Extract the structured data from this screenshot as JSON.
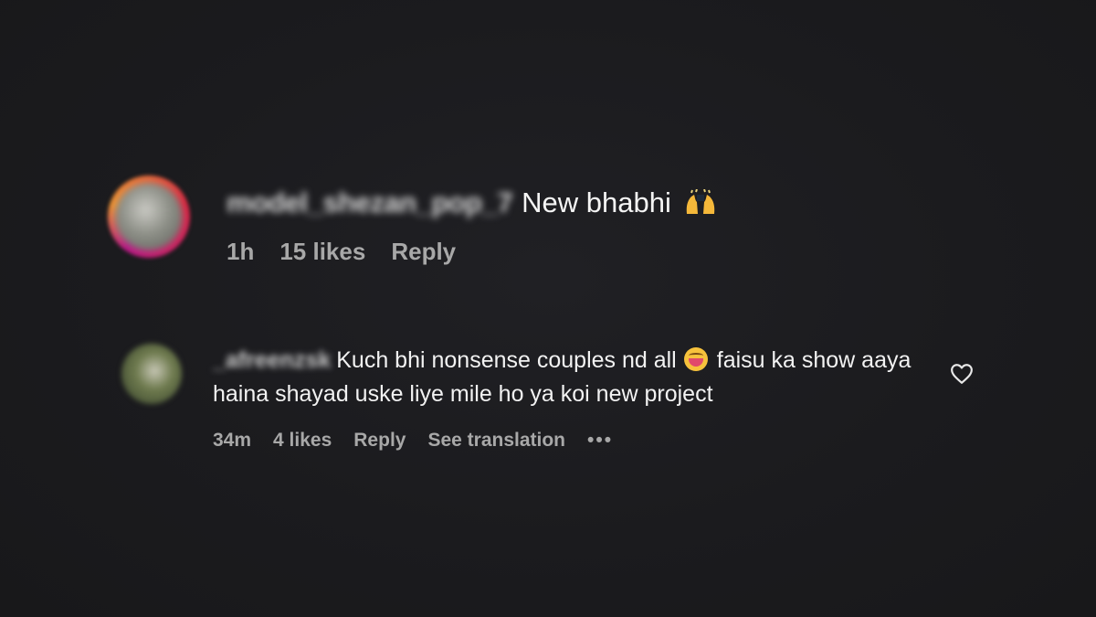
{
  "comments": [
    {
      "username": "model_shezan_pop_7",
      "text": "New bhabhi",
      "emoji": "raising-hands-emoji",
      "time": "1h",
      "likes": "15 likes",
      "reply_label": "Reply"
    },
    {
      "username": "_afreenzsk",
      "text_part1": "Kuch bhi nonsense couples nd all",
      "emoji": "laughing-emoji",
      "text_part2": "faisu ka show aaya haina shayad uske liye mile ho ya koi new project",
      "time": "34m",
      "likes": "4 likes",
      "reply_label": "Reply",
      "translation_label": "See translation",
      "more_label": "•••",
      "like_icon": "heart-outline-icon"
    }
  ],
  "colors": {
    "background": "#1b1b1e",
    "text_primary": "#f2f2f2",
    "text_secondary": "#a8a8a8",
    "story_ring": "#dc2743"
  }
}
